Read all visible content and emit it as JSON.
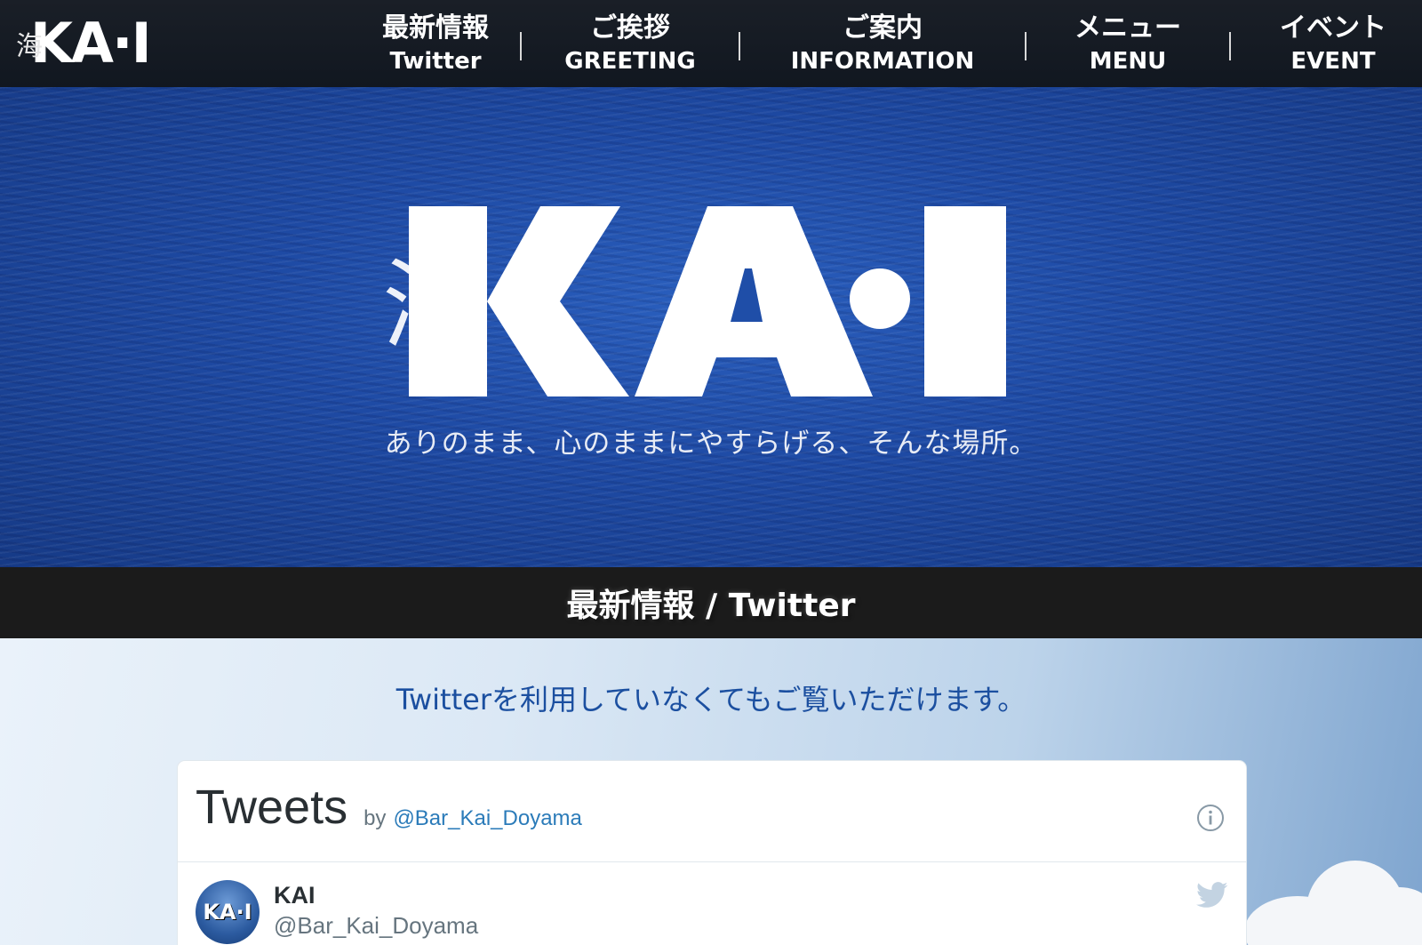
{
  "header": {
    "logo": {
      "kanji": "海",
      "word": "KA·I"
    },
    "nav": [
      {
        "jp": "最新情報",
        "en": "Twitter"
      },
      {
        "jp": "ご挨拶",
        "en": "GREETING"
      },
      {
        "jp": "ご案内",
        "en": "INFORMATION"
      },
      {
        "jp": "メニュー",
        "en": "MENU"
      },
      {
        "jp": "イベント",
        "en": "EVENT"
      }
    ]
  },
  "hero": {
    "logo": {
      "kanji": "海",
      "word": "KA·I"
    },
    "tagline": "ありのまま、心のままにやすらげる、そんな場所。"
  },
  "section": {
    "title": "最新情報 / Twitter"
  },
  "notice": "Twitterを利用していなくてもご覧いただけます。",
  "widget": {
    "title": "Tweets",
    "by": "by",
    "handle": "@Bar_Kai_Doyama",
    "info_icon": "info-icon",
    "tweet": {
      "name": "KAI",
      "handle": "@Bar_Kai_Doyama",
      "avatar_text": "KA·I",
      "bird_icon": "twitter-bird-icon"
    }
  },
  "colors": {
    "header_bg": "#151b24",
    "hero_blue": "#1e4aa4",
    "section_bar": "#1b1b1b",
    "notice_text": "#1b4fa0",
    "twitter_link": "#2b7bb9",
    "twitter_blue": "#1da1f2"
  }
}
